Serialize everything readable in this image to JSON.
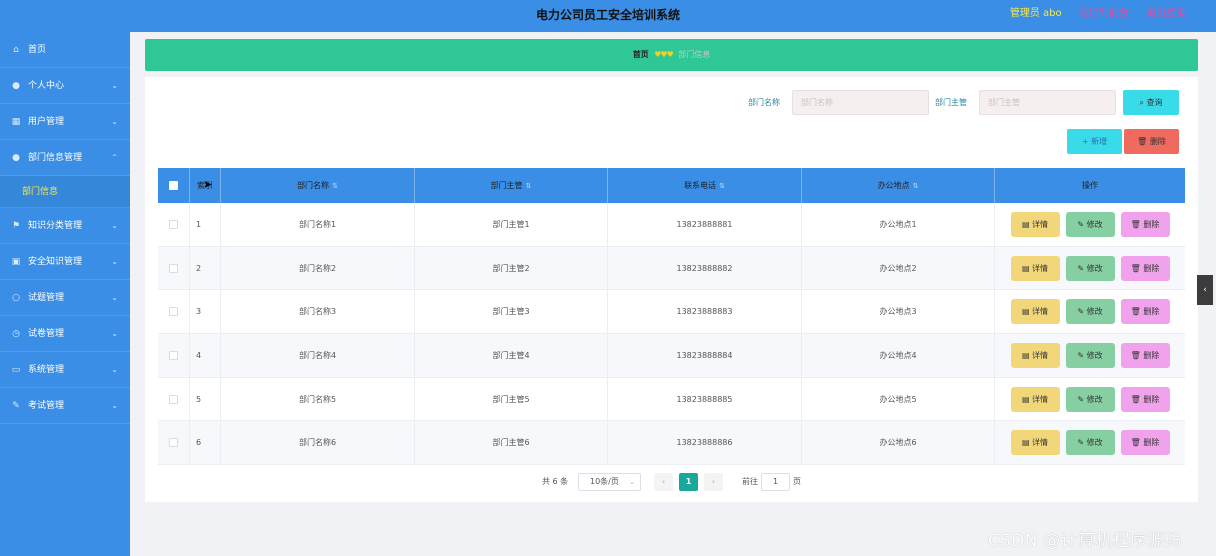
{
  "header": {
    "title": "电力公司员工安全培训系统",
    "admin": "管理员 abo",
    "back_home": "退出到前台",
    "logout": "退出登录"
  },
  "sidebar": {
    "items": [
      {
        "label": "首页",
        "icon": "home-icon"
      },
      {
        "label": "个人中心",
        "icon": "user-icon"
      },
      {
        "label": "用户管理",
        "icon": "grid-icon"
      },
      {
        "label": "部门信息管理",
        "icon": "user-icon"
      },
      {
        "label": "知识分类管理",
        "icon": "flag-icon"
      },
      {
        "label": "安全知识管理",
        "icon": "briefcase-icon"
      },
      {
        "label": "试题管理",
        "icon": "circle-icon"
      },
      {
        "label": "试卷管理",
        "icon": "clock-icon"
      },
      {
        "label": "系统管理",
        "icon": "chat-icon"
      },
      {
        "label": "考试管理",
        "icon": "edit-icon"
      }
    ],
    "sub_item": "部门信息"
  },
  "breadcrumb": {
    "home": "首页",
    "hearts": "♥♥♥",
    "current": "部门信息"
  },
  "search": {
    "dept_name_label": "部门名称",
    "dept_name_placeholder": "部门名称",
    "dept_head_label": "部门主管",
    "dept_head_placeholder": "部门主管",
    "query_label": "查询"
  },
  "actions": {
    "add_label": "新增",
    "delete_label": "删除"
  },
  "table": {
    "columns": {
      "index": "索引",
      "dept_name": "部门名称",
      "dept_head": "部门主管",
      "phone": "联系电话",
      "location": "办公地点",
      "ops": "操作"
    },
    "op_labels": {
      "detail": "详情",
      "edit": "修改",
      "delete": "删除"
    },
    "rows": [
      {
        "index": "1",
        "dept_name": "部门名称1",
        "dept_head": "部门主管1",
        "phone": "13823888881",
        "location": "办公地点1"
      },
      {
        "index": "2",
        "dept_name": "部门名称2",
        "dept_head": "部门主管2",
        "phone": "13823888882",
        "location": "办公地点2"
      },
      {
        "index": "3",
        "dept_name": "部门名称3",
        "dept_head": "部门主管3",
        "phone": "13823888883",
        "location": "办公地点3"
      },
      {
        "index": "4",
        "dept_name": "部门名称4",
        "dept_head": "部门主管4",
        "phone": "13823888884",
        "location": "办公地点4"
      },
      {
        "index": "5",
        "dept_name": "部门名称5",
        "dept_head": "部门主管5",
        "phone": "13823888885",
        "location": "办公地点5"
      },
      {
        "index": "6",
        "dept_name": "部门名称6",
        "dept_head": "部门主管6",
        "phone": "13823888886",
        "location": "办公地点6"
      }
    ]
  },
  "pagination": {
    "total": "共 6 条",
    "page_size": "10条/页",
    "current_page": "1",
    "goto_label": "前往",
    "goto_value": "1",
    "page_word": "页"
  },
  "watermark": "CSDN @计算机程序源码",
  "colors": {
    "primary": "#3a8ee6",
    "breadcrumb_bg": "#2ec795",
    "query_btn": "#3adbe8",
    "delete_btn": "#f06a5f",
    "detail_btn": "#f1d67a",
    "edit_btn": "#86cfa2",
    "remove_btn": "#f1a2ec",
    "active_page": "#1aa89a"
  }
}
